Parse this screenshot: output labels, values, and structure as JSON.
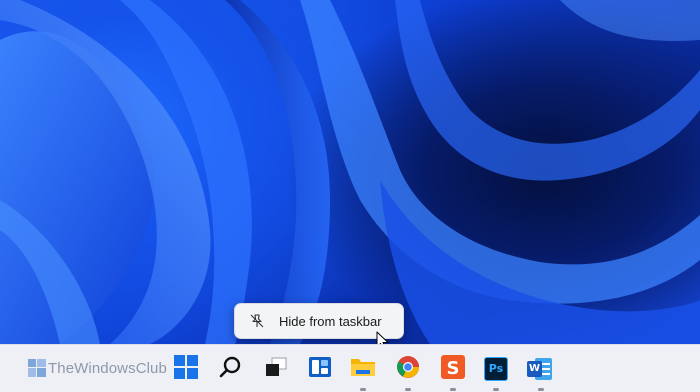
{
  "brand": {
    "text": "TheWindowsClub"
  },
  "context_menu": {
    "items": [
      {
        "label": "Hide from taskbar",
        "icon": "unpin-icon"
      }
    ]
  },
  "taskbar": {
    "icons": [
      {
        "name": "start-button",
        "icon": "windows-logo-icon"
      },
      {
        "name": "search-button",
        "icon": "search-icon"
      },
      {
        "name": "task-view-button",
        "icon": "task-view-icon"
      },
      {
        "name": "widgets-button",
        "icon": "widgets-icon"
      },
      {
        "name": "file-explorer-button",
        "icon": "folder-icon"
      },
      {
        "name": "chrome-button",
        "icon": "chrome-icon"
      },
      {
        "name": "sogou-button",
        "icon": "s-app-icon"
      },
      {
        "name": "photoshop-button",
        "icon": "photoshop-icon",
        "text": "Ps"
      },
      {
        "name": "word-button",
        "icon": "word-icon",
        "text": "W"
      }
    ]
  },
  "colors": {
    "wallpaper_primary": "#1553ea",
    "wallpaper_dark": "#061a66",
    "taskbar_bg": "#eef0f5",
    "menu_bg": "#f3f4f6"
  }
}
